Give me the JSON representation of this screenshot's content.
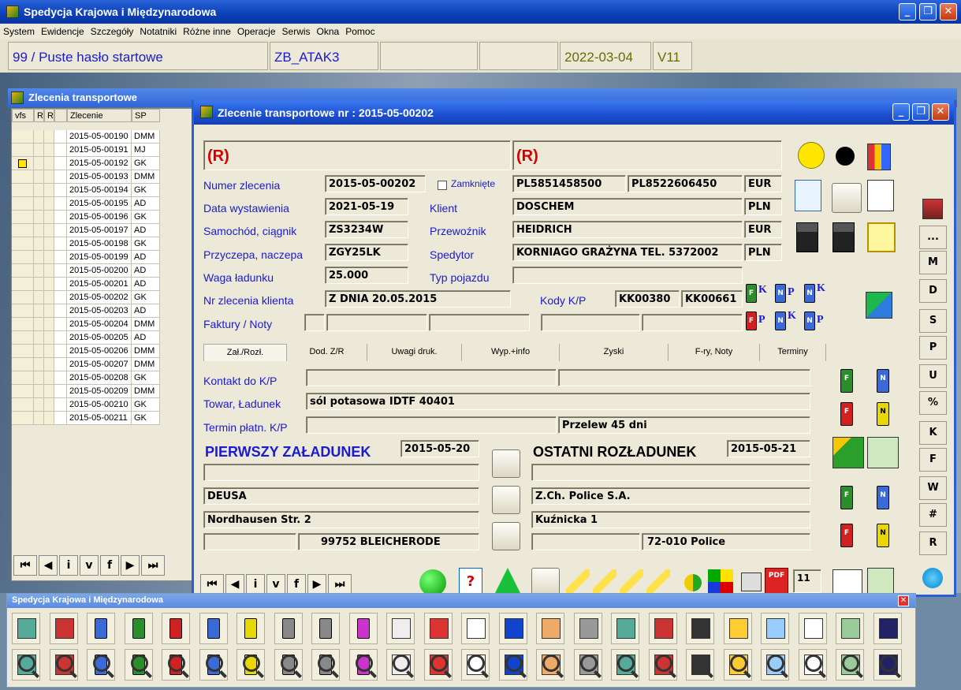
{
  "app": {
    "title": "Spedycja Krajowa i Międzynarodowa",
    "menu": [
      "System",
      "Ewidencje",
      "Szczegóły",
      "Notatniki",
      "Różne inne",
      "Operacje",
      "Serwis",
      "Okna",
      "Pomoc"
    ],
    "status": {
      "user": "99 / Puste hasło startowe",
      "db": "ZB_ATAK3",
      "date": "2022-03-04",
      "version": "V11"
    }
  },
  "list_window": {
    "title": "Zlecenia transportowe",
    "columns": [
      "vfs",
      "R",
      "R",
      "Zlecenie",
      "SP"
    ],
    "rows": [
      {
        "zl": "2015-05-00190",
        "sp": "DMM",
        "flag": false
      },
      {
        "zl": "2015-05-00191",
        "sp": "MJ",
        "flag": false
      },
      {
        "zl": "2015-05-00192",
        "sp": "GK",
        "flag": true
      },
      {
        "zl": "2015-05-00193",
        "sp": "DMM",
        "flag": false
      },
      {
        "zl": "2015-05-00194",
        "sp": "GK",
        "flag": false
      },
      {
        "zl": "2015-05-00195",
        "sp": "AD",
        "flag": false
      },
      {
        "zl": "2015-05-00196",
        "sp": "GK",
        "flag": false
      },
      {
        "zl": "2015-05-00197",
        "sp": "AD",
        "flag": false
      },
      {
        "zl": "2015-05-00198",
        "sp": "GK",
        "flag": false
      },
      {
        "zl": "2015-05-00199",
        "sp": "AD",
        "flag": false
      },
      {
        "zl": "2015-05-00200",
        "sp": "AD",
        "flag": false
      },
      {
        "zl": "2015-05-00201",
        "sp": "AD",
        "flag": false
      },
      {
        "zl": "2015-05-00202",
        "sp": "GK",
        "flag": false
      },
      {
        "zl": "2015-05-00203",
        "sp": "AD",
        "flag": false
      },
      {
        "zl": "2015-05-00204",
        "sp": "DMM",
        "flag": false
      },
      {
        "zl": "2015-05-00205",
        "sp": "AD",
        "flag": false
      },
      {
        "zl": "2015-05-00206",
        "sp": "DMM",
        "flag": false
      },
      {
        "zl": "2015-05-00207",
        "sp": "DMM",
        "flag": false
      },
      {
        "zl": "2015-05-00208",
        "sp": "GK",
        "flag": false
      },
      {
        "zl": "2015-05-00209",
        "sp": "DMM",
        "flag": false
      },
      {
        "zl": "2015-05-00210",
        "sp": "GK",
        "flag": false
      },
      {
        "zl": "2015-05-00211",
        "sp": "GK",
        "flag": false
      }
    ],
    "nav": [
      "⏮",
      "◀",
      "i",
      "v",
      "f",
      "▶",
      "⏭"
    ]
  },
  "order_window": {
    "title": "Zlecenie transportowe nr : 2015-05-00202",
    "top_left": "(R)",
    "top_right": "(R)",
    "labels": {
      "numer": "Numer zlecenia",
      "data": "Data wystawienia",
      "samochod": "Samochód, ciągnik",
      "przyczepa": "Przyczepa, naczepa",
      "waga": "Waga ładunku",
      "nrklienta": "Nr zlecenia klienta",
      "faktury": "Faktury / Noty",
      "zamkniete": "Zamknięte",
      "klient": "Klient",
      "przewoznik": "Przewoźnik",
      "spedytor": "Spedytor",
      "typ": "Typ pojazdu",
      "kody": "Kody K/P"
    },
    "values": {
      "numer": "2015-05-00202",
      "data": "2021-05-19",
      "samochod": "ZS3234W",
      "przyczepa": "ZGY25LK",
      "waga": "25.000",
      "nrklienta": "Z DNIA 20.05.2015",
      "nip1": "PL5851458500",
      "nip2": "PL8522606450",
      "cur1": "EUR",
      "klient": "DOSCHEM",
      "cur2": "PLN",
      "przewoznik": "HEIDRICH",
      "cur3": "EUR",
      "spedytor": "KORNIAGO GRAŻYNA  TEL. 5372002",
      "cur4": "PLN",
      "kod1": "KK00380",
      "kod2": "KK00661"
    },
    "tabs": [
      "Zał./Rozł.",
      "Dod. Z/R",
      "Uwagi druk.",
      "Wyp.+info",
      "Zyski",
      "F-ry, Noty",
      "Terminy"
    ],
    "tab_labels": {
      "kontakt": "Kontakt do K/P",
      "towar": "Towar, Ładunek",
      "termin": "Termin płatn. K/P"
    },
    "tab_values": {
      "towar": "sól potasowa IDTF  40401",
      "przelew": "Przelew 45 dni"
    },
    "load": {
      "heading": "PIERWSZY ZAŁADUNEK",
      "date": "2015-05-20",
      "name": "DEUSA",
      "street": "Nordhausen Str. 2",
      "city": "99752 BLEICHERODE"
    },
    "unload": {
      "heading": "OSTATNI ROZŁADUNEK",
      "date": "2015-05-21",
      "name": "Z.Ch. Police S.A.",
      "street": "Kuźnicka 1",
      "city": "72-010 Police"
    },
    "bottom_count": "11",
    "side_buttons": [
      "...",
      "M",
      "D",
      "S",
      "P",
      "U",
      "%",
      "K",
      "F",
      "W",
      "#",
      "R"
    ]
  },
  "toolbar_window": {
    "title": "Spedycja Krajowa i Międzynarodowa"
  },
  "colors": {
    "accent": "#1a1ad0",
    "red": "#d40000",
    "xpblue": "#2a5fd0"
  }
}
